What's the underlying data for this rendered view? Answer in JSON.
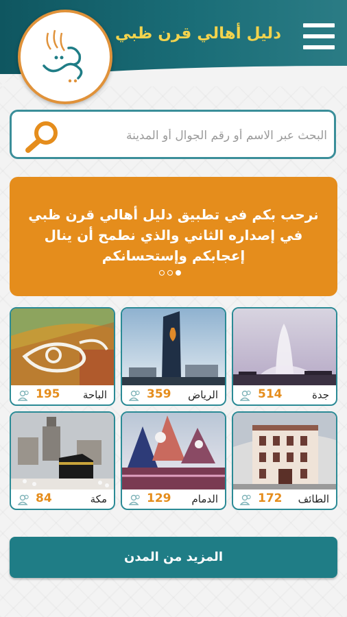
{
  "header": {
    "title": "دليل أهالي قرن ظبي",
    "logo_text": "قرن ظبي"
  },
  "search": {
    "placeholder": "البحث عبر الاسم أو رقم الجوال أو المدينة",
    "value": ""
  },
  "banner": {
    "text": "نرحب بكم في تطبيق دليل أهالي قرن ظبي في إصداره الثاني والذي نطمح أن ينال إعجابكم وإستحسانكم",
    "slides": 3,
    "active_slide": 3
  },
  "cities": [
    {
      "name": "جدة",
      "count": "514",
      "photo": "fountain"
    },
    {
      "name": "الرياض",
      "count": "359",
      "photo": "tower"
    },
    {
      "name": "الباحة",
      "count": "195",
      "photo": "mosaic"
    },
    {
      "name": "الطائف",
      "count": "172",
      "photo": "building"
    },
    {
      "name": "الدمام",
      "count": "129",
      "photo": "sails"
    },
    {
      "name": "مكة",
      "count": "84",
      "photo": "kaaba"
    }
  ],
  "more_button": {
    "label": "المزيد من المدن"
  },
  "colors": {
    "teal": "#1f7d86",
    "orange": "#e58d1c",
    "title_yellow": "#f2d34d"
  }
}
